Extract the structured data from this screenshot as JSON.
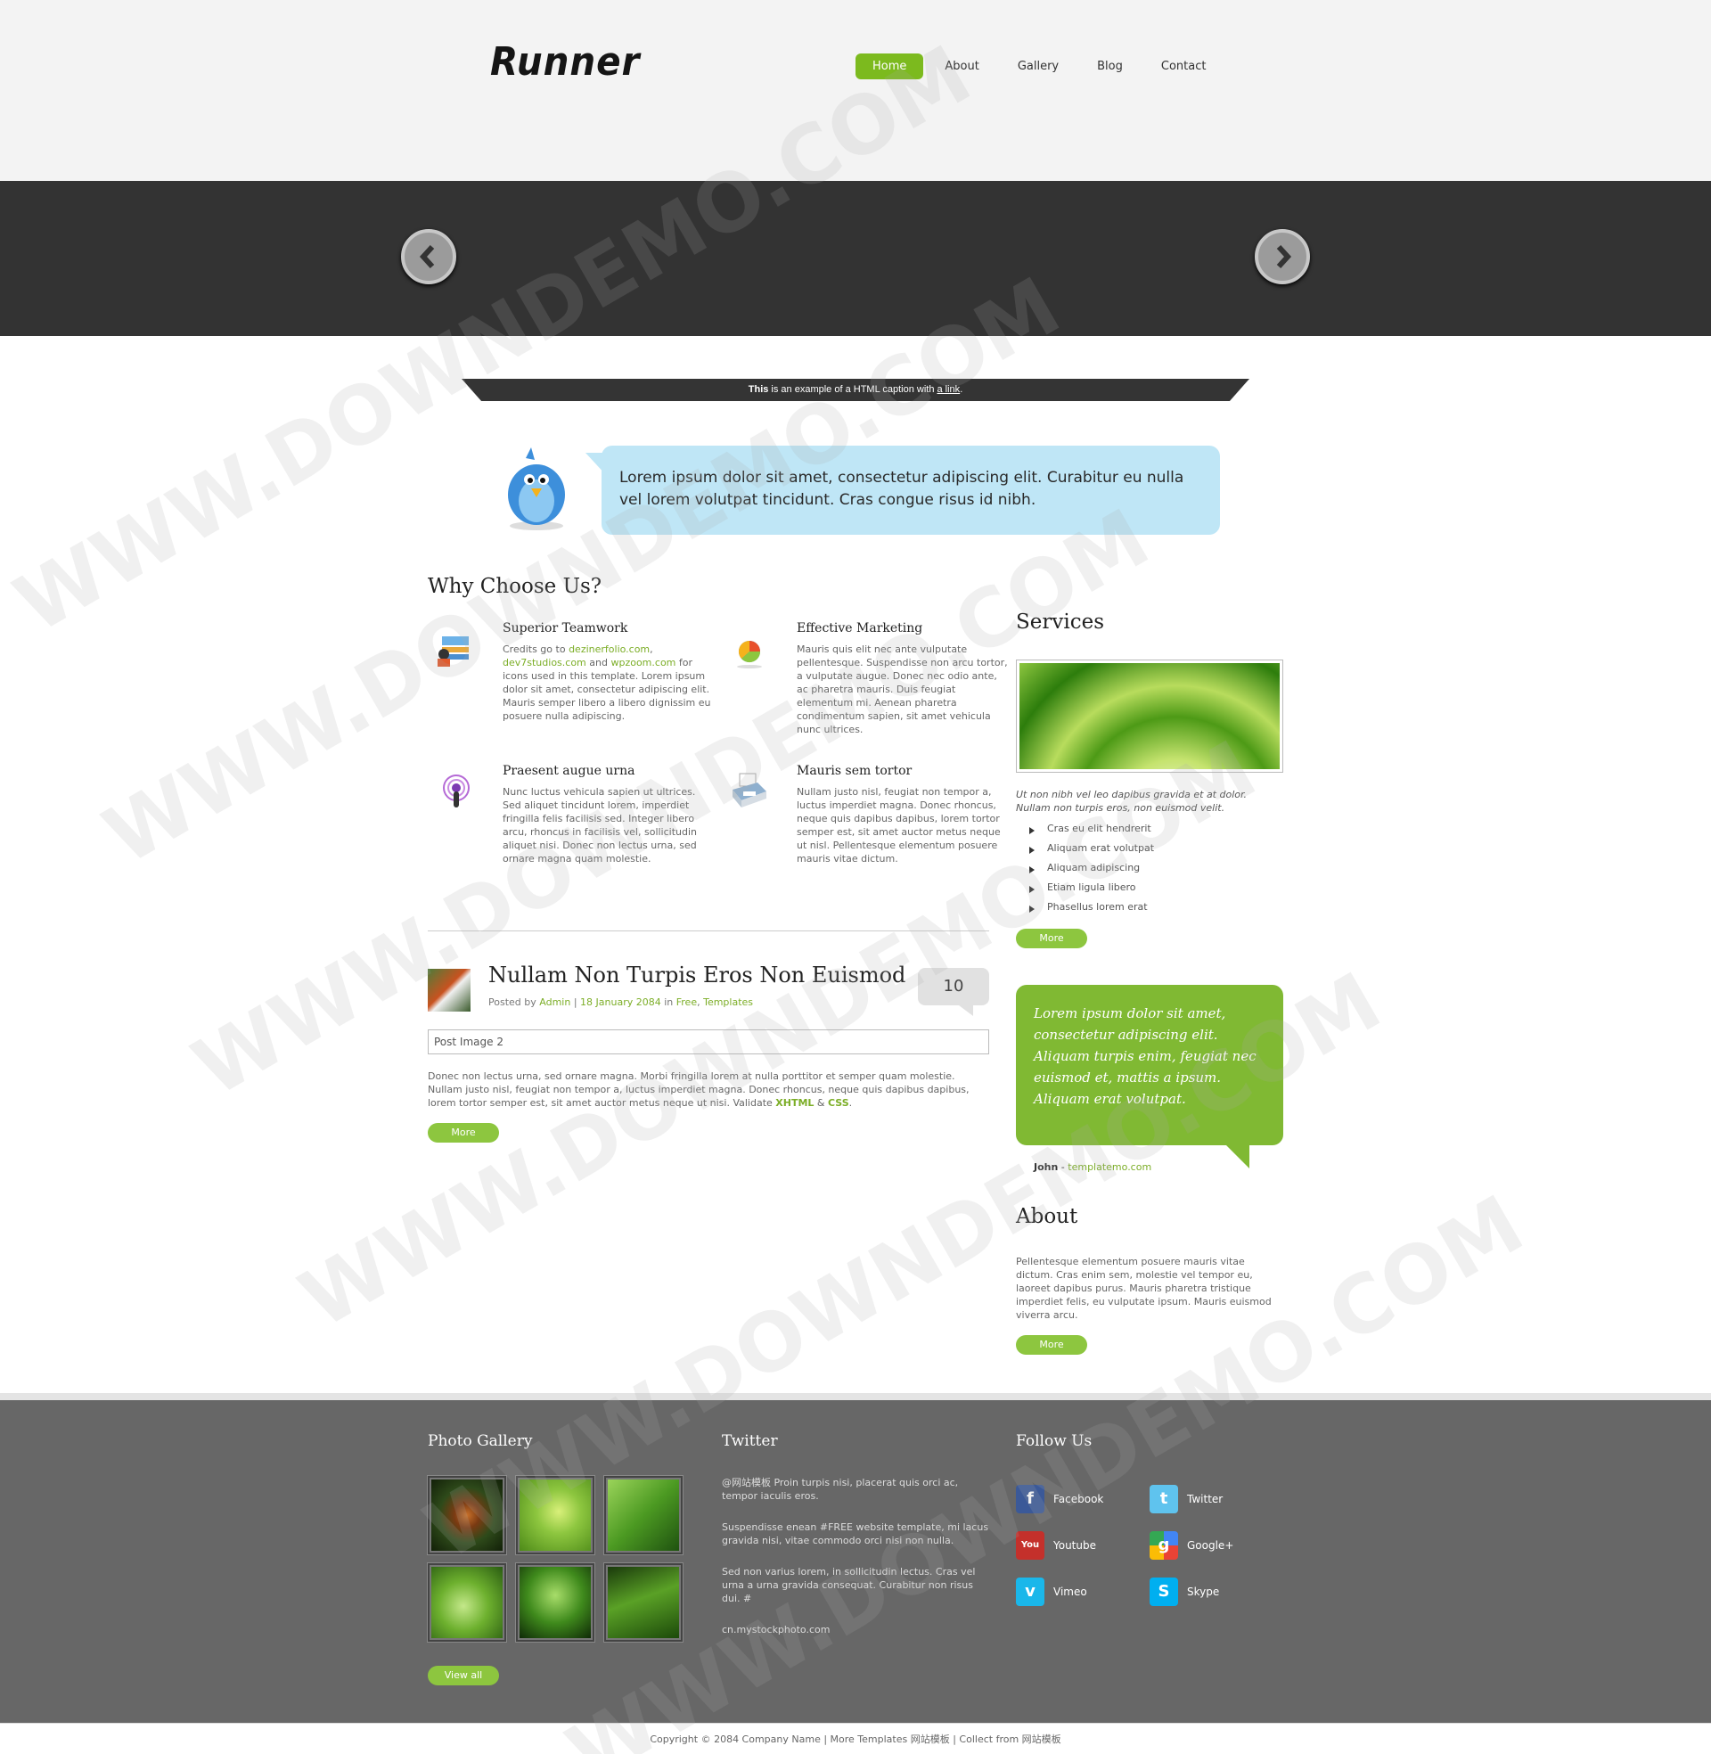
{
  "header": {
    "logo": "Runner",
    "nav": [
      "Home",
      "About",
      "Gallery",
      "Blog",
      "Contact"
    ]
  },
  "caption": {
    "bold": "This",
    "text": " is an example of a HTML caption with ",
    "link": "a link",
    "end": "."
  },
  "intro": {
    "text": "Lorem ipsum dolor sit amet, consectetur adipiscing elit. Curabitur eu nulla vel lorem volutpat tincidunt. Cras congue risus id nibh."
  },
  "why": {
    "title": "Why Choose Us?",
    "features": [
      {
        "title": "Superior Teamwork",
        "pre": "Credits go to ",
        "link1": "dezinerfolio.com",
        "sep1": ", ",
        "link2": "dev7studios.com",
        "sep2": " and ",
        "link3": "wpzoom.com",
        "text": " for icons used in this template. Lorem ipsum dolor sit amet, consectetur adipiscing elit. Mauris semper libero a libero dignissim eu posuere nulla adipiscing.",
        "icon": "teamwork-icon"
      },
      {
        "title": "Effective Marketing",
        "text": "Mauris quis elit nec ante vulputate pellentesque. Suspendisse non arcu tortor, a vulputate augue. Donec nec odio ante, ac pharetra mauris. Duis feugiat elementum mi. Aenean pharetra condimentum sapien, sit amet vehicula nunc ultrices.",
        "icon": "pie-chart-icon"
      },
      {
        "title": "Praesent augue urna",
        "text": "Nunc luctus vehicula sapien ut ultrices. Sed aliquet tincidunt lorem, imperdiet fringilla felis facilisis sed. Integer libero arcu, rhoncus in facilisis vel, sollicitudin aliquet nisi. Donec non lectus urna, sed ornare magna quam molestie.",
        "icon": "podcast-icon"
      },
      {
        "title": "Mauris sem tortor",
        "text": "Nullam justo nisl, feugiat non tempor a, luctus imperdiet magna. Donec rhoncus, neque quis dapibus dapibus, lorem tortor semper est, sit amet auctor metus neque ut nisl. Pellentesque elementum posuere mauris vitae dictum.",
        "icon": "printer-icon"
      }
    ]
  },
  "post": {
    "title": "Nullam Non Turpis Eros Non Euismod",
    "meta_posted": "Posted by ",
    "author": "Admin",
    "sep": " | ",
    "date": "18 January 2084",
    "in": " in ",
    "cat1": "Free",
    "comma": ", ",
    "cat2": "Templates",
    "comments": "10",
    "image_alt": "Post Image 2",
    "text": "Donec non lectus urna, sed ornare magna. Morbi fringilla lorem at nulla porttitor et semper quam molestie. Nullam justo nisl, feugiat non tempor a, luctus imperdiet magna. Donec rhoncus, neque quis dapibus dapibus, lorem tortor semper est, sit amet auctor metus neque ut nisi. Validate ",
    "xhtml": "XHTML",
    "amp": " & ",
    "css": "CSS",
    "dot": ".",
    "more": "More"
  },
  "services": {
    "title": "Services",
    "desc": "Ut non nibh vel leo dapibus gravida et at dolor. Nullam non turpis eros, non euismod velit.",
    "items": [
      "Cras eu elit hendrerit",
      "Aliquam erat volutpat",
      "Aliquam adipiscing",
      "Etiam ligula libero",
      "Phasellus lorem erat"
    ],
    "more": "More"
  },
  "testimonial": {
    "text": "Lorem ipsum dolor sit amet, consectetur adipiscing elit. Aliquam turpis enim, feugiat nec euismod et, mattis a ipsum. Aliquam erat volutpat.",
    "author": "John",
    "dash": " - ",
    "site": "templatemo.com"
  },
  "about": {
    "title": "About",
    "text": "Pellentesque elementum posuere mauris vitae dictum. Cras enim sem, molestie vel tempor eu, laoreet dapibus purus. Mauris pharetra tristique imperdiet felis, eu vulputate ipsum. Mauris euismod viverra arcu.",
    "more": "More"
  },
  "footer": {
    "gallery_title": "Photo Gallery",
    "view_all": "View all",
    "twitter_title": "Twitter",
    "tweets": [
      "@网站模板 Proin turpis nisi, placerat quis orci ac, tempor iaculis eros.",
      "Suspendisse enean #FREE website template, mi lacus gravida nisi, vitae commodo orci nisi non nulla.",
      "Sed non varius lorem, in sollicitudin lectus. Cras vel urna a urna gravida consequat. Curabitur non risus dui. #",
      "cn.mystockphoto.com"
    ],
    "follow_title": "Follow Us",
    "social": [
      "Facebook",
      "Twitter",
      "Youtube",
      "Google+",
      "Vimeo",
      "Skype"
    ],
    "copyright": "Copyright © 2084 Company Name | More Templates 网站模板 | Collect from 网站模板"
  },
  "watermark": "WWW.DOWNDEMO.COM",
  "colors": {
    "accent": "#8dc63f",
    "dark": "#333333",
    "bubble": "#bfe6f6"
  }
}
